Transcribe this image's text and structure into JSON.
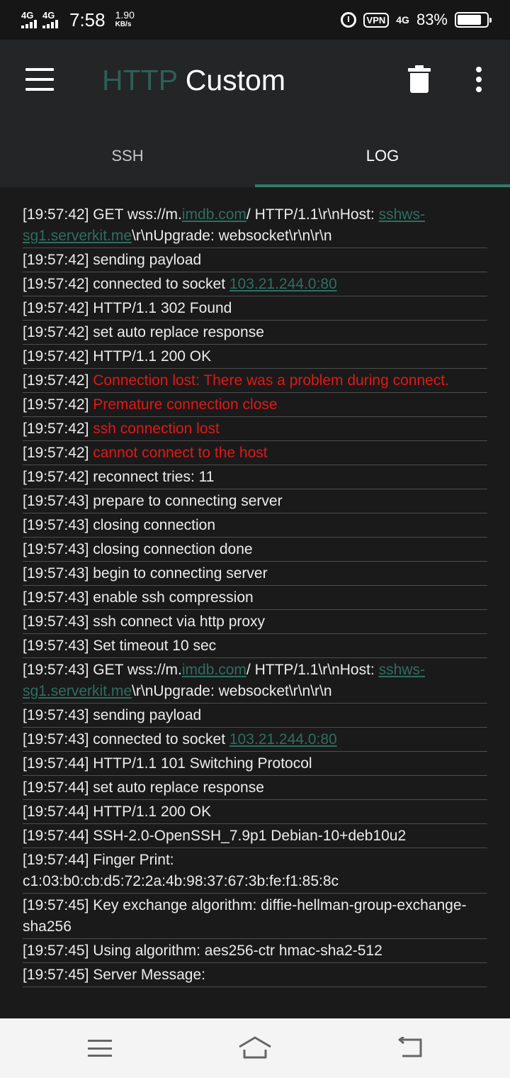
{
  "status_bar": {
    "sim1_label": "4G",
    "sim2_label": "4G",
    "time": "7:58",
    "speed_value": "1.90",
    "speed_unit": "KB/s",
    "vpn_label": "VPN",
    "network_label": "4G",
    "battery_percent": "83%",
    "battery_level": 0.83
  },
  "app_bar": {
    "title_part1": "HTTP",
    "title_part2": "Custom",
    "tabs": [
      {
        "label": "SSH",
        "active": false
      },
      {
        "label": "LOG",
        "active": true
      }
    ]
  },
  "colors": {
    "accent": "#2e7d6b",
    "error": "#e01818",
    "link": "#2e6e60"
  },
  "log": [
    {
      "time": "[19:57:42]",
      "parts": [
        {
          "t": "GET wss://m."
        },
        {
          "t": "imdb.com",
          "link": true
        },
        {
          "t": "/ HTTP/1.1\\r\\nHost: "
        },
        {
          "t": "sshws-sg1.serverkit.me",
          "link": true
        },
        {
          "t": "\\r\\nUpgrade: websocket\\r\\n\\r\\n"
        }
      ]
    },
    {
      "time": "[19:57:42]",
      "parts": [
        {
          "t": "sending payload"
        }
      ]
    },
    {
      "time": "[19:57:42]",
      "parts": [
        {
          "t": "connected to socket "
        },
        {
          "t": "103.21.244.0:80",
          "link": true
        }
      ]
    },
    {
      "time": "[19:57:42]",
      "parts": [
        {
          "t": "HTTP/1.1 302 Found"
        }
      ]
    },
    {
      "time": "[19:57:42]",
      "parts": [
        {
          "t": "set auto replace response"
        }
      ]
    },
    {
      "time": "[19:57:42]",
      "parts": [
        {
          "t": "HTTP/1.1 200 OK"
        }
      ]
    },
    {
      "time": "[19:57:42]",
      "error": true,
      "parts": [
        {
          "t": "Connection lost: There was a problem during connect."
        }
      ]
    },
    {
      "time": "[19:57:42]",
      "error": true,
      "parts": [
        {
          "t": "Premature connection close"
        }
      ]
    },
    {
      "time": "[19:57:42]",
      "error": true,
      "parts": [
        {
          "t": "ssh connection lost"
        }
      ]
    },
    {
      "time": "[19:57:42]",
      "error": true,
      "parts": [
        {
          "t": "cannot connect to the host"
        }
      ]
    },
    {
      "time": "[19:57:42]",
      "parts": [
        {
          "t": "reconnect tries: 11"
        }
      ]
    },
    {
      "time": "[19:57:43]",
      "parts": [
        {
          "t": "prepare to connecting server"
        }
      ]
    },
    {
      "time": "[19:57:43]",
      "parts": [
        {
          "t": "closing connection"
        }
      ]
    },
    {
      "time": "[19:57:43]",
      "parts": [
        {
          "t": "closing connection done"
        }
      ]
    },
    {
      "time": "[19:57:43]",
      "parts": [
        {
          "t": "begin to connecting server"
        }
      ]
    },
    {
      "time": "[19:57:43]",
      "parts": [
        {
          "t": "enable ssh compression"
        }
      ]
    },
    {
      "time": "[19:57:43]",
      "parts": [
        {
          "t": "ssh connect via http proxy"
        }
      ]
    },
    {
      "time": "[19:57:43]",
      "parts": [
        {
          "t": "Set timeout 10 sec"
        }
      ]
    },
    {
      "time": "[19:57:43]",
      "parts": [
        {
          "t": "GET wss://m."
        },
        {
          "t": "imdb.com",
          "link": true
        },
        {
          "t": "/ HTTP/1.1\\r\\nHost: "
        },
        {
          "t": "sshws-sg1.serverkit.me",
          "link": true
        },
        {
          "t": "\\r\\nUpgrade: websocket\\r\\n\\r\\n"
        }
      ]
    },
    {
      "time": "[19:57:43]",
      "parts": [
        {
          "t": "sending payload"
        }
      ]
    },
    {
      "time": "[19:57:43]",
      "parts": [
        {
          "t": "connected to socket "
        },
        {
          "t": "103.21.244.0:80",
          "link": true
        }
      ]
    },
    {
      "time": "[19:57:44]",
      "parts": [
        {
          "t": "HTTP/1.1 101 Switching Protocol"
        }
      ]
    },
    {
      "time": "[19:57:44]",
      "parts": [
        {
          "t": "set auto replace response"
        }
      ]
    },
    {
      "time": "[19:57:44]",
      "parts": [
        {
          "t": "HTTP/1.1 200 OK"
        }
      ]
    },
    {
      "time": "[19:57:44]",
      "parts": [
        {
          "t": "SSH-2.0-OpenSSH_7.9p1 Debian-10+deb10u2"
        }
      ]
    },
    {
      "time": "[19:57:44]",
      "parts": [
        {
          "t": "Finger Print: c1:03:b0:cb:d5:72:2a:4b:98:37:67:3b:fe:f1:85:8c"
        }
      ]
    },
    {
      "time": "[19:57:45]",
      "parts": [
        {
          "t": "Key exchange algorithm: diffie-hellman-group-exchange-sha256"
        }
      ]
    },
    {
      "time": "[19:57:45]",
      "parts": [
        {
          "t": "Using algorithm: aes256-ctr hmac-sha2-512"
        }
      ]
    },
    {
      "time": "[19:57:45]",
      "parts": [
        {
          "t": "Server Message:"
        }
      ]
    }
  ]
}
